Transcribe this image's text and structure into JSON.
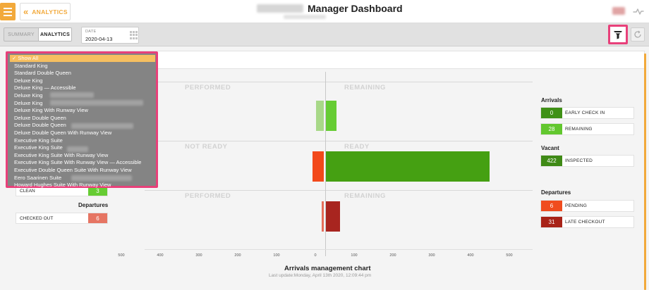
{
  "header": {
    "title": "Manager Dashboard",
    "analytics_button": "ANALYTICS",
    "menu_icon": "hamburger-icon",
    "back_icon": "double-chevron-left-icon",
    "activity_icon": "pulse-icon"
  },
  "toolbar": {
    "tabs": [
      {
        "label": "SUMMARY",
        "active": false
      },
      {
        "label": "ANALYTICS",
        "active": true
      }
    ],
    "date_label": "DATE",
    "date_value": "2020-04-13",
    "calendar_icon": "grid-icon",
    "filter_icon": "filter-icon",
    "refresh_icon": "refresh-icon"
  },
  "room_type_filter": {
    "items": [
      "✓ Show All",
      "Standard King",
      "Standard Double Queen",
      "Deluxe King",
      "Deluxe King — Accessible",
      "Deluxe King",
      "Deluxe King",
      "Deluxe King With Runway View",
      "Deluxe Double Queen",
      "Deluxe Double Queen",
      "Deluxe Double Queen With Runway View",
      "Executive King Suite",
      "Executive King Suite",
      "Executive King Suite With Runway View",
      "Executive King Suite With Runway View — Accessible",
      "Executive Double Queen Suite With Runway View",
      "Eero Saarinen Suite",
      "Howard Hughes Suite With Runway View"
    ],
    "selected_index": 0
  },
  "chart_data": {
    "type": "bar",
    "orientation": "horizontal",
    "title": "Arrivals management chart",
    "subtitle": "Last update:Monday, April 13th 2020, 12:09:44 pm",
    "xlim": [
      -500,
      500
    ],
    "x_ticks": [
      -500,
      -400,
      -300,
      -200,
      -100,
      0,
      100,
      200,
      300,
      400,
      500
    ],
    "x_tick_labels": [
      "500",
      "400",
      "300",
      "200",
      "100",
      "0",
      "100",
      "200",
      "300",
      "400",
      "500"
    ],
    "sections": [
      {
        "left_label": "PERFORMED",
        "right_label": "REMAINING",
        "bars": [
          {
            "value": -20,
            "color": "#a8d888"
          },
          {
            "value": 28,
            "color": "#66cc33"
          }
        ]
      },
      {
        "left_label": "NOT READY",
        "right_label": "READY",
        "bars": [
          {
            "value": -30,
            "color": "#f2491b"
          },
          {
            "value": 422,
            "color": "#45a012"
          }
        ]
      },
      {
        "left_label": "PERFORMED",
        "right_label": "REMAINING",
        "bars": [
          {
            "value": -6,
            "color": "#e56e5a"
          },
          {
            "value": 37,
            "color": "#a8251f"
          }
        ]
      }
    ]
  },
  "right_stats": {
    "arrivals_heading": "Arrivals",
    "early_check_in": {
      "value": "0",
      "label": "EARLY CHECK IN",
      "color": "#3f9016"
    },
    "remaining": {
      "value": "28",
      "label": "REMAINING",
      "color": "#62c72e"
    },
    "vacant_heading": "Vacant",
    "inspected": {
      "value": "422",
      "label": "INSPECTED",
      "color": "#3f8a16"
    },
    "departures_heading": "Departures",
    "pending": {
      "value": "6",
      "label": "PENDING",
      "color": "#f04c1e"
    },
    "late_checkout": {
      "value": "31",
      "label": "LATE CHECKOUT",
      "color": "#a82318"
    }
  },
  "left_stats": {
    "clean": {
      "label": "CLEAN",
      "value": "3",
      "color": "#66cc33"
    },
    "departures_heading": "Departures",
    "checked_out": {
      "label": "CHECKED OUT",
      "value": "6",
      "color": "#e67563"
    }
  }
}
